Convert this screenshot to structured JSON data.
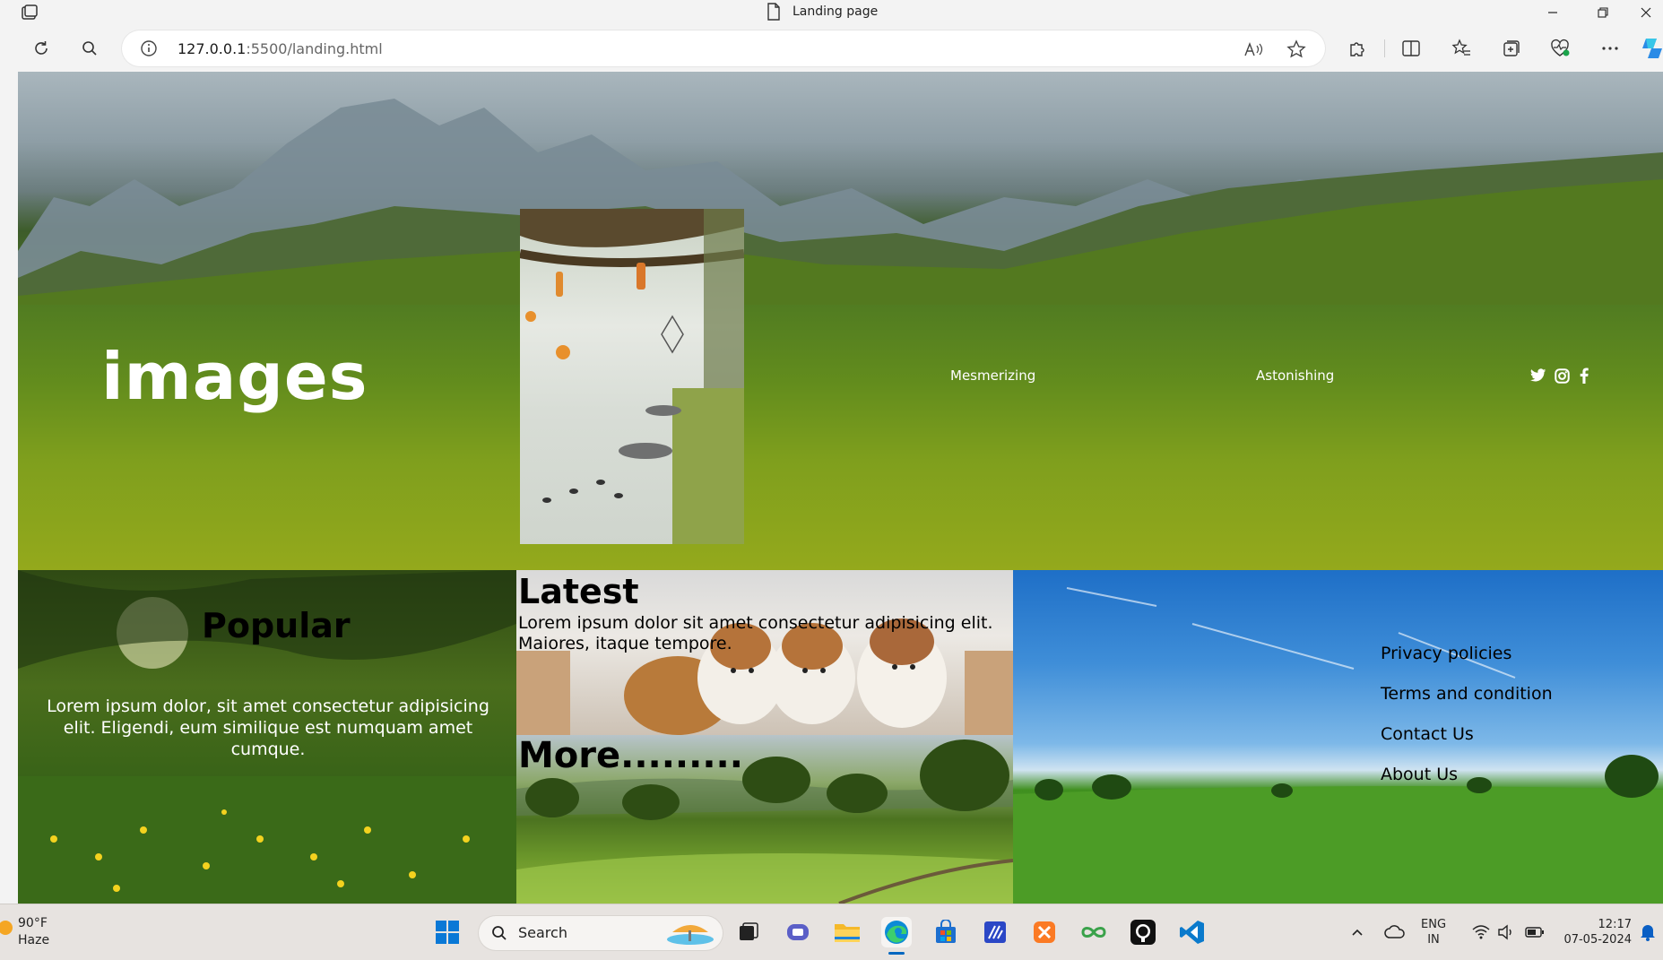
{
  "window": {
    "title": "Landing page"
  },
  "browser": {
    "url_host": "127.0.0.1",
    "url_path": ":5500/landing.html"
  },
  "hero": {
    "title": "images",
    "links": [
      "Mesmerizing",
      "Astonishing"
    ],
    "social": [
      "twitter-icon",
      "instagram-icon",
      "facebook-icon"
    ]
  },
  "popular": {
    "title": "Popular",
    "text": "Lorem ipsum dolor, sit amet consectetur adipisicing elit. Eligendi, eum similique est numquam amet cumque."
  },
  "latest": {
    "title": "Latest",
    "text": "Lorem ipsum dolor sit amet consectetur adipisicing elit. Maiores, itaque tempore."
  },
  "more": {
    "title": "More........."
  },
  "footer": {
    "links": [
      "Privacy policies",
      "Terms and condition",
      "Contact Us",
      "About Us"
    ]
  },
  "taskbar": {
    "weather_temp": "90°F",
    "weather_desc": "Haze",
    "search_label": "Search",
    "lang_top": "ENG",
    "lang_bottom": "IN",
    "time": "12:17",
    "date": "07-05-2024"
  },
  "colors": {
    "accent_edge": "#0078d4",
    "vscode": "#0a7acc",
    "github": "#111111"
  }
}
